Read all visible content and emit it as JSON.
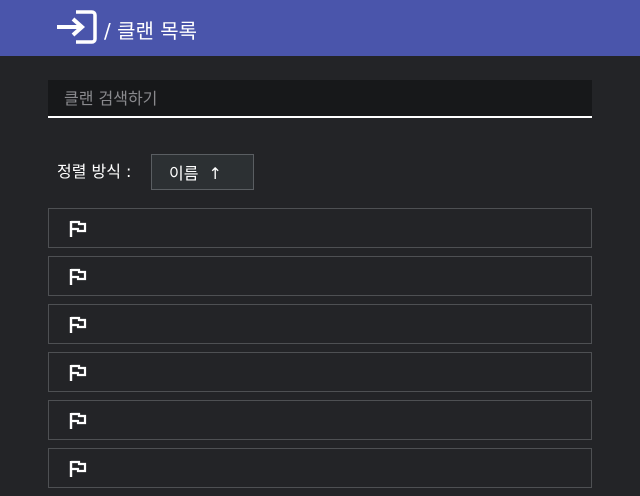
{
  "header": {
    "title": "/ 클랜 목록",
    "icon": "login-icon"
  },
  "search": {
    "placeholder": "클랜 검색하기",
    "value": ""
  },
  "sort": {
    "label": "정렬 방식 :",
    "value": "이름",
    "direction_symbol": "↑"
  },
  "clans": [
    {
      "icon": "flag-icon",
      "name": ""
    },
    {
      "icon": "flag-icon",
      "name": ""
    },
    {
      "icon": "flag-icon",
      "name": ""
    },
    {
      "icon": "flag-icon",
      "name": ""
    },
    {
      "icon": "flag-icon",
      "name": ""
    },
    {
      "icon": "flag-icon",
      "name": ""
    }
  ],
  "colors": {
    "header_bg": "#4a55ab",
    "page_bg": "#232427",
    "search_bg": "#17181a",
    "item_border": "#4e5053"
  }
}
